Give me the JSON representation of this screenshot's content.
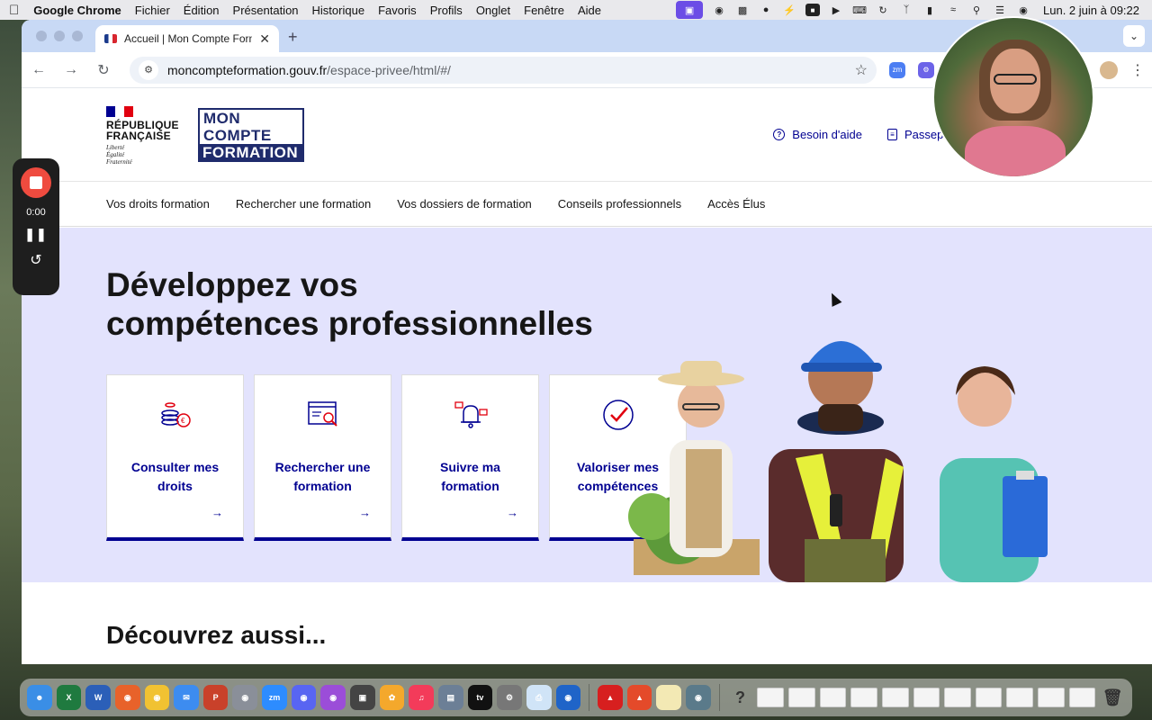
{
  "menubar": {
    "app": "Google Chrome",
    "items": [
      "Fichier",
      "Édition",
      "Présentation",
      "Historique",
      "Favoris",
      "Profils",
      "Onglet",
      "Fenêtre",
      "Aide"
    ],
    "clock": "Lun. 2 juin à 09:22"
  },
  "browser": {
    "tab_title": "Accueil | Mon Compte Formati",
    "url_host": "moncompteformation.gouv.fr",
    "url_path": "/espace-privee/html/#/"
  },
  "header": {
    "rf_name": "RÉPUBLIQUE FRANÇAISE",
    "rf_motto": [
      "Liberté",
      "Égalité",
      "Fraternité"
    ],
    "logo_lines": [
      "MON",
      "COMPTE",
      "FORMATION"
    ],
    "help_link": "Besoin d'aide",
    "passports_link": "Passeports"
  },
  "nav": [
    "Vos droits formation",
    "Rechercher une formation",
    "Vos dossiers de formation",
    "Conseils professionnels",
    "Accès Élus"
  ],
  "hero": {
    "title_line1": "Développez vos",
    "title_line2": "compétences professionnelles",
    "cards": [
      {
        "label": "Consulter mes droits",
        "icon": "coins-euro-icon",
        "arrow": "→"
      },
      {
        "label": "Rechercher une formation",
        "icon": "search-document-icon",
        "arrow": "→"
      },
      {
        "label": "Suivre ma formation",
        "icon": "notification-bell-icon",
        "arrow": "→"
      },
      {
        "label": "Valoriser mes compétences",
        "icon": "checkmark-circle-icon",
        "arrow": "↗"
      }
    ]
  },
  "section2": {
    "title": "Découvrez aussi..."
  },
  "recorder": {
    "time": "0:00"
  },
  "colors": {
    "brand_blue": "#000091",
    "hero_bg": "#e3e3fd",
    "rec_red": "#ef4b3f"
  }
}
